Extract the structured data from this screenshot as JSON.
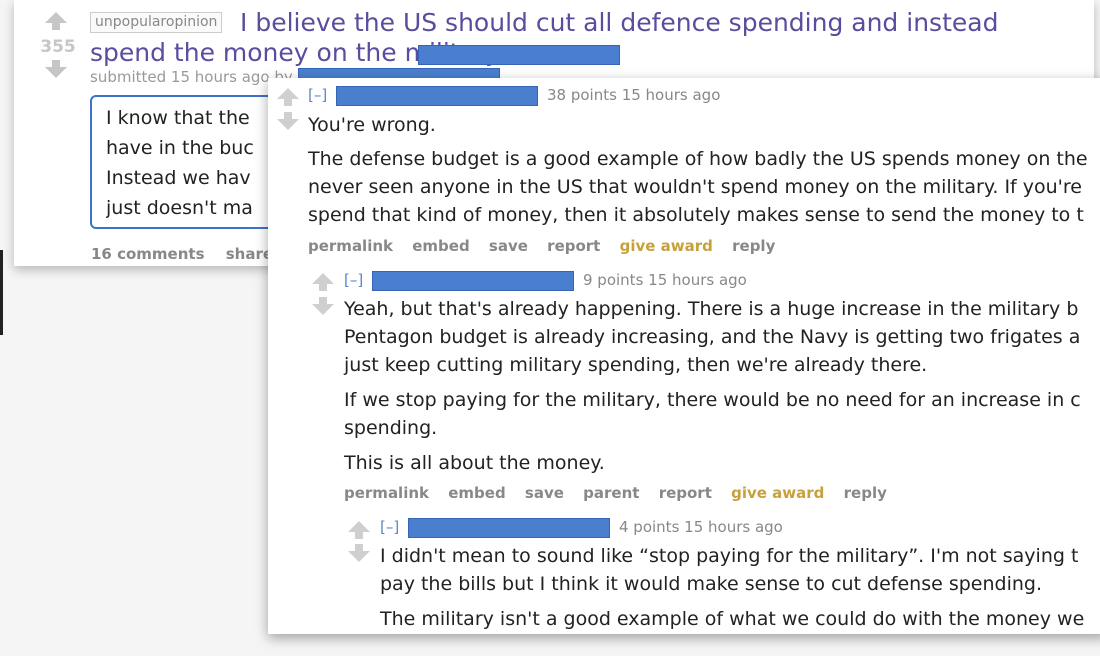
{
  "post": {
    "score": "355",
    "subreddit": "unpopularopinion",
    "title": "I believe the US should cut all defence spending and instead spend the money on the military",
    "submitted": "submitted 15 hours ago by",
    "selftext_lines": [
      "I know that the",
      "have in the buc",
      "Instead we hav",
      "just doesn't ma"
    ],
    "links": [
      "16 comments",
      "share"
    ]
  },
  "comments": [
    {
      "collapse": "[–]",
      "points": "38 points 15 hours ago",
      "body": [
        "You're wrong.",
        "The defense budget is a good example of how badly the US spends money on the",
        "never seen anyone in the US that wouldn't spend money on the military. If you're",
        "spend that kind of money, then it absolutely makes sense to send the money to t"
      ],
      "links": [
        "permalink",
        "embed",
        "save",
        "report",
        "give award",
        "reply"
      ]
    },
    {
      "collapse": "[–]",
      "points": "9 points 15 hours ago",
      "body": [
        "Yeah, but that's already happening. There is a huge increase in the military b",
        "Pentagon budget is already increasing, and the Navy is getting two frigates a",
        "just keep cutting military spending, then we're already there.",
        "If we stop paying for the military, there would be no need for an increase in c",
        "spending.",
        "This is all about the money."
      ],
      "links": [
        "permalink",
        "embed",
        "save",
        "parent",
        "report",
        "give award",
        "reply"
      ]
    },
    {
      "collapse": "[–]",
      "points": "4 points 15 hours ago",
      "body": [
        "I didn't mean to sound like “stop paying for the military”. I'm not saying t",
        "pay the bills but I think it would make sense to cut defense spending.",
        "The military isn't a good example of what we could do with the money we"
      ]
    }
  ],
  "colors": {
    "title": "#5a4c9e",
    "redaction": "#4a7fcf",
    "award": "#c8a13a",
    "border": "#3d73c6"
  }
}
